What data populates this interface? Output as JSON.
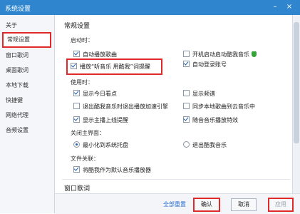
{
  "window": {
    "title": "系统设置",
    "minimize": "–",
    "close": "×"
  },
  "sidebar": {
    "items": [
      {
        "label": "关于"
      },
      {
        "label": "常规设置"
      },
      {
        "label": "窗口歌词"
      },
      {
        "label": "桌面歌词"
      },
      {
        "label": "本地下载"
      },
      {
        "label": "快捷键"
      },
      {
        "label": "网络代理"
      },
      {
        "label": "音频设置"
      }
    ]
  },
  "main": {
    "section_title": "常规设置",
    "startup": {
      "label": "启动时：",
      "auto_play": "自动播放歌曲",
      "boot_start": "开机启动启动酷我音乐",
      "auto_login": "自动登录账号",
      "listen_use": "播放“听音乐 用酷我”词提醒"
    },
    "using": {
      "label": "使用时：",
      "show_today": "显示今日看点",
      "show_sound": "显示频谱",
      "exit_add": "退出酷我音乐时退出播放加速引擎",
      "sync_local": "同步本地歌曲到云音乐中",
      "show_theme": "显示主播上线提醒",
      "smart_effect": "随音音乐播放特效"
    },
    "close_main": {
      "label": "关闭主界面：",
      "minimize_tray": "最小化到系统托盘",
      "exit_app": "退出酷我音乐"
    },
    "file_assoc": {
      "label": "文件关联：",
      "default_player": "将酷我作为默认音乐播放器"
    },
    "next_section": "窗口歌词"
  },
  "footer": {
    "restore_all": "全部重置",
    "ok": "确认",
    "cancel": "取消",
    "apply": "应用"
  }
}
